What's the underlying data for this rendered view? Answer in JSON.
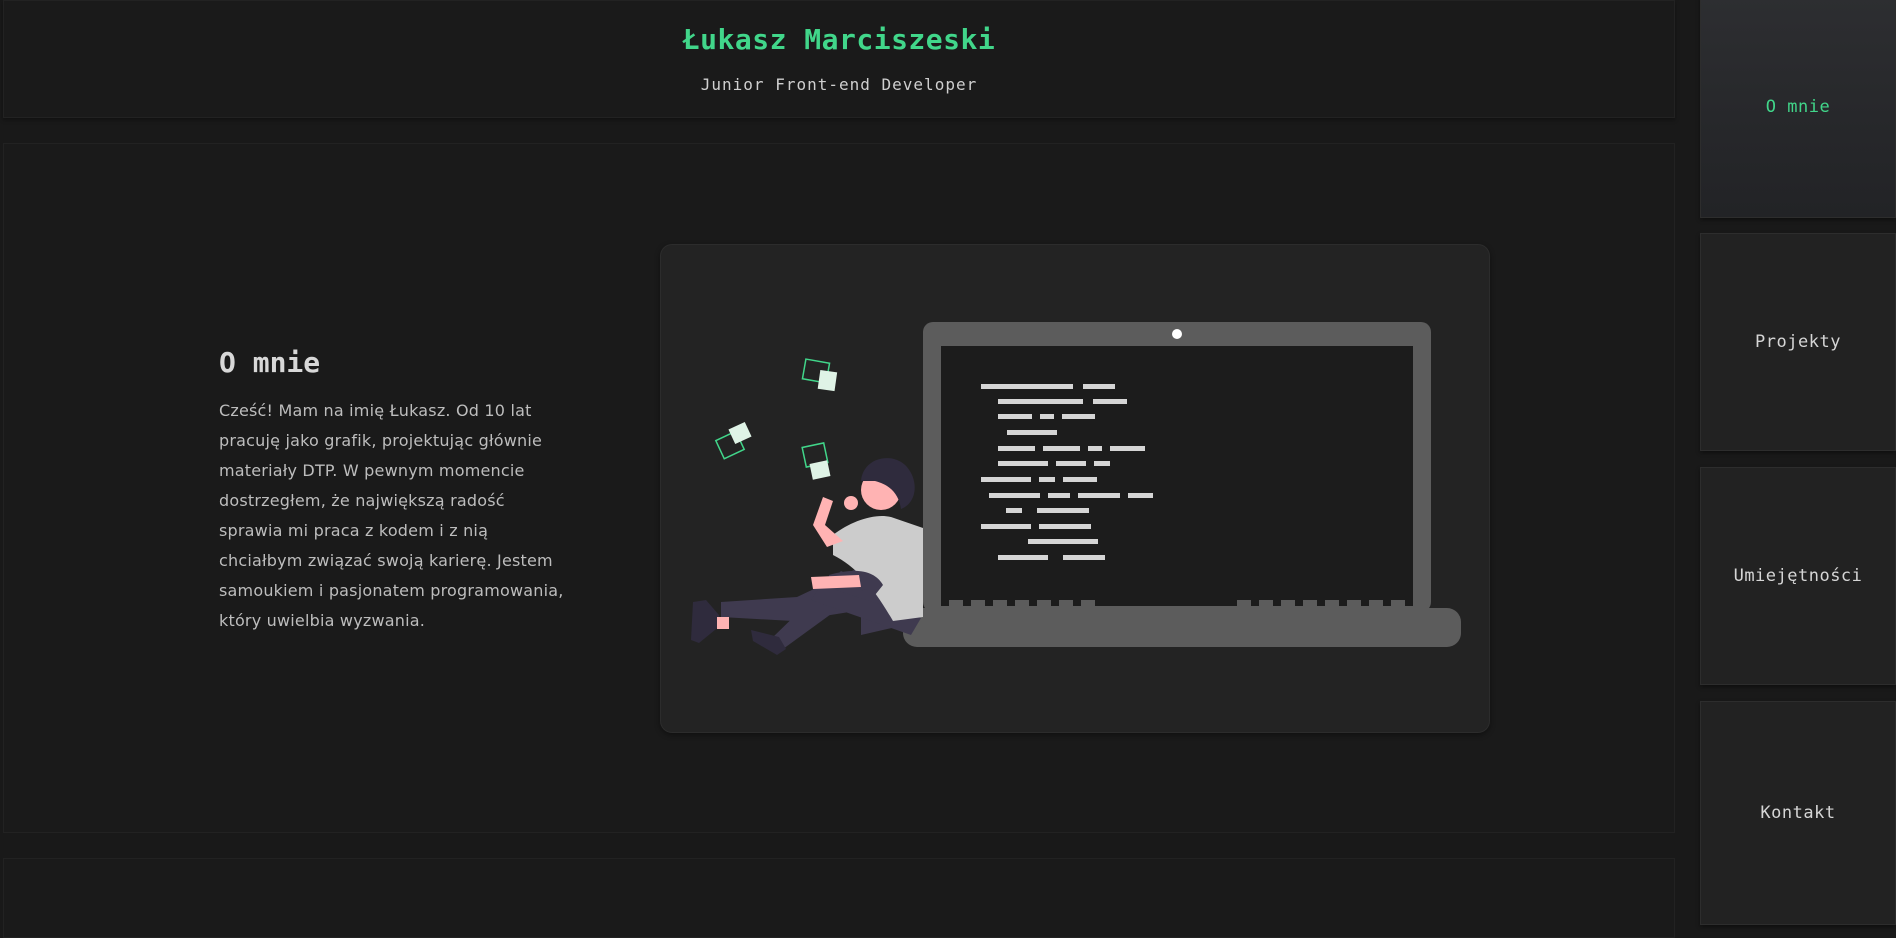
{
  "header": {
    "title": "Łukasz Marciszeski",
    "subtitle": "Junior Front-end Developer"
  },
  "about": {
    "heading": "O mnie",
    "text": "Cześć! Mam na imię Łukasz. Od 10 lat pracuję jako grafik, projektując głównie materiały DTP. W pewnym momencie dostrzegłem, że największą radość sprawia mi praca z kodem i z nią chciałbym związać swoją karierę. Jestem samoukiem i pasjonatem programowania, który uwielbia wyzwania."
  },
  "nav": {
    "items": [
      {
        "label": "O mnie",
        "active": true
      },
      {
        "label": "Projekty",
        "active": false
      },
      {
        "label": "Umiejętności",
        "active": false
      },
      {
        "label": "Kontakt",
        "active": false
      }
    ]
  },
  "colors": {
    "accent": "#41d68a",
    "background": "#191919",
    "panel": "#222222",
    "text": "#d6d6d6"
  },
  "icons": {
    "illustration": "programmer-with-laptop-illustration"
  }
}
